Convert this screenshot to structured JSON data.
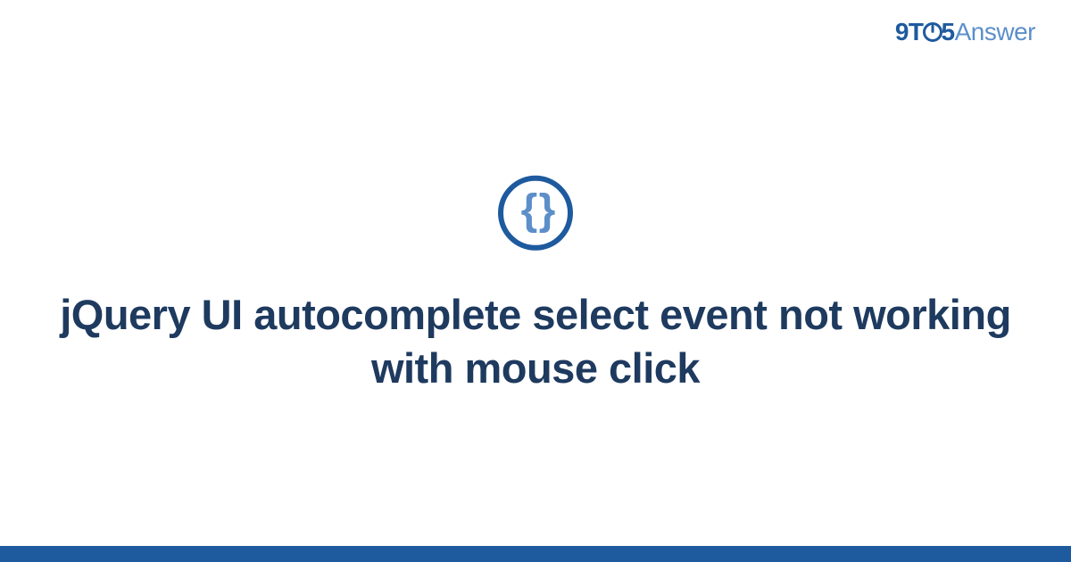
{
  "logo": {
    "part1": "9T",
    "part2": "5",
    "part3": "Answer"
  },
  "icon": {
    "symbol": "{ }",
    "name": "code-braces"
  },
  "title": "jQuery UI autocomplete select event not working with mouse click",
  "colors": {
    "primary": "#1e5a9e",
    "secondary": "#5c8fc9",
    "title": "#1e3a5f"
  }
}
